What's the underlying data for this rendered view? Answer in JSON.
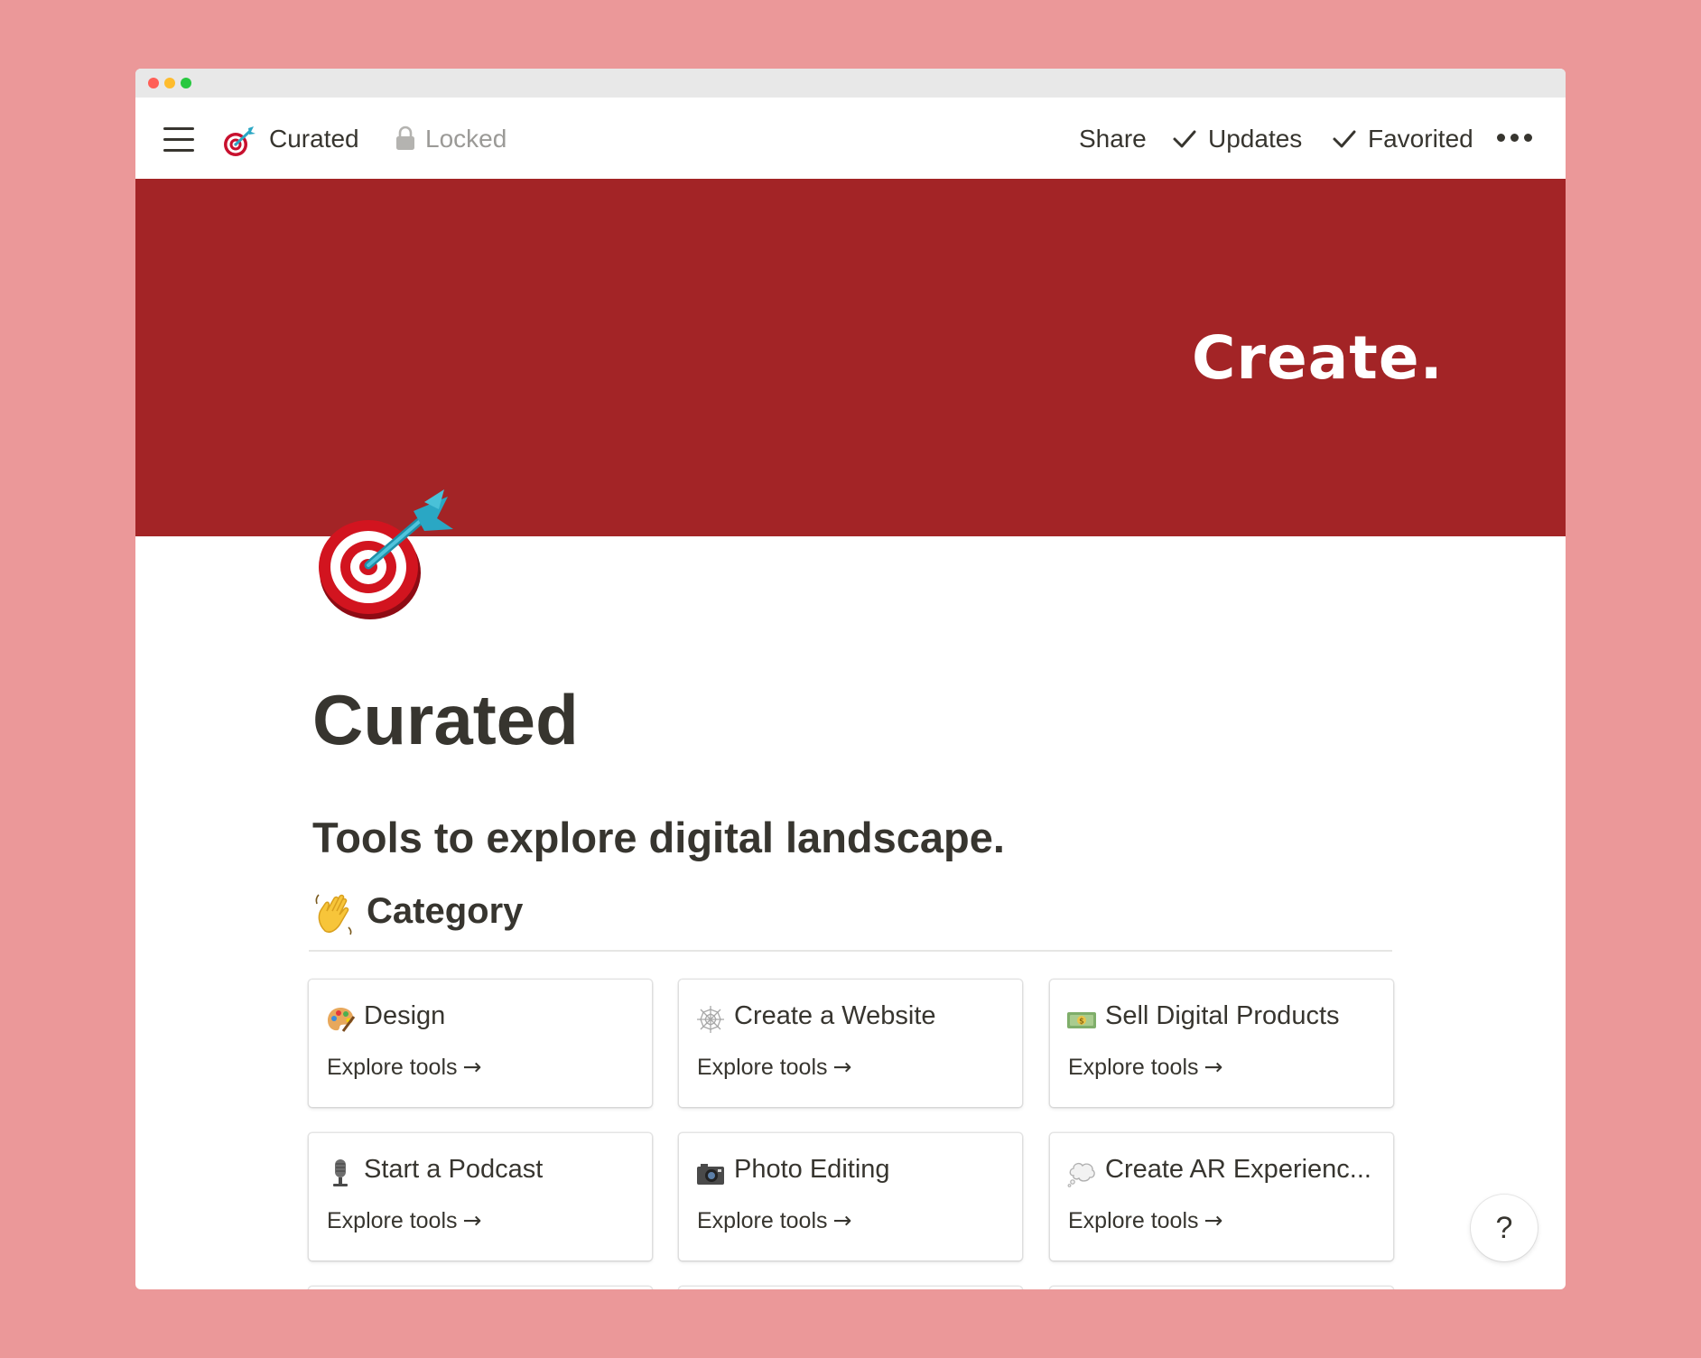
{
  "topbar": {
    "breadcrumb_title": "Curated",
    "locked_label": "Locked",
    "share_label": "Share",
    "updates_label": "Updates",
    "favorited_label": "Favorited"
  },
  "cover": {
    "text": "Create.",
    "color": "#A32426"
  },
  "page": {
    "title": "Curated",
    "subtitle": "Tools to explore digital landscape.",
    "category_heading": "Category"
  },
  "cards": [
    {
      "icon": "palette-icon",
      "title": "Design",
      "link": "Explore tools"
    },
    {
      "icon": "spider-web-icon",
      "title": "Create a Website",
      "link": "Explore tools"
    },
    {
      "icon": "money-icon",
      "title": "Sell Digital Products",
      "link": "Explore tools"
    },
    {
      "icon": "microphone-icon",
      "title": "Start a Podcast",
      "link": "Explore tools"
    },
    {
      "icon": "camera-icon",
      "title": "Photo Editing",
      "link": "Explore tools"
    },
    {
      "icon": "thought-bubble-icon",
      "title": "Create AR Experienc...",
      "link": "Explore tools"
    }
  ],
  "help_label": "?",
  "background_color": "#EB9899"
}
